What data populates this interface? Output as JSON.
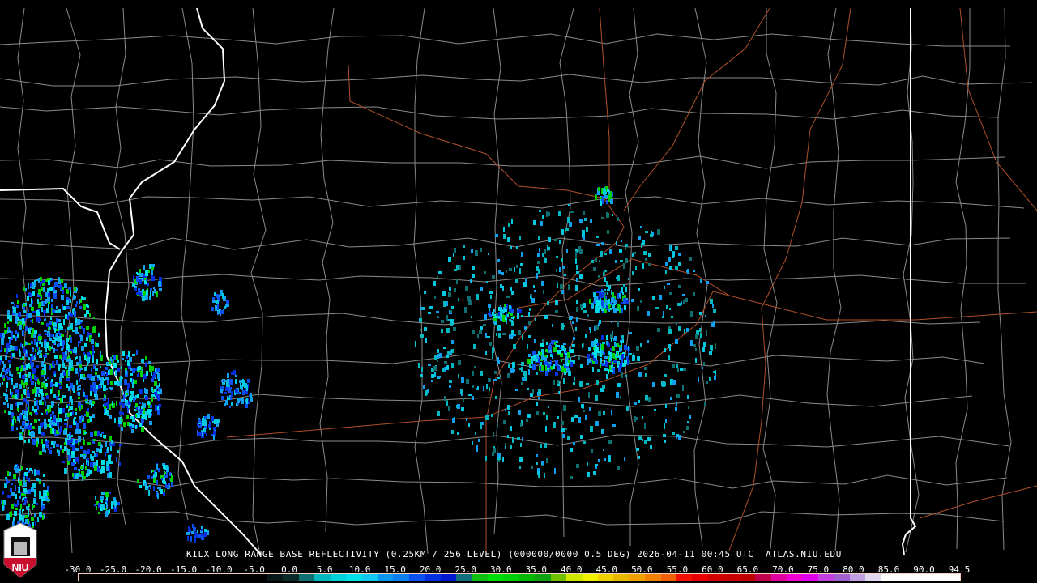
{
  "product_title": "KILX LONG RANGE BASE REFLECTIVITY (0.25KM / 256 LEVEL) (000000/0000 0.5 DEG) 2026-04-11 00:45 UTC  ATLAS.NIU.EDU",
  "logo_text": "NIU",
  "colorbar": {
    "labels": [
      "-30.0",
      "-25.0",
      "-20.0",
      "-15.0",
      "-10.0",
      "-5.0",
      "0.0",
      "5.0",
      "10.0",
      "15.0",
      "20.0",
      "25.0",
      "30.0",
      "35.0",
      "40.0",
      "45.0",
      "50.0",
      "55.0",
      "60.0",
      "65.0",
      "70.0",
      "75.0",
      "80.0",
      "85.0",
      "90.0",
      "94.5"
    ],
    "colors": [
      "#000000",
      "#000000",
      "#000000",
      "#000000",
      "#000000",
      "#000000",
      "#000000",
      "#000000",
      "#000000",
      "#000000",
      "#000000",
      "#000000",
      "#081818",
      "#0a2a2a",
      "#0e7070",
      "#00b8c0",
      "#00d0d8",
      "#00e0e8",
      "#10c8f0",
      "#0898f0",
      "#0a80f0",
      "#0850f0",
      "#0030e0",
      "#0018d0",
      "#107080",
      "#10c010",
      "#00e000",
      "#00d000",
      "#00b800",
      "#10a010",
      "#70c000",
      "#d0e800",
      "#f0f000",
      "#f0d000",
      "#e8b800",
      "#f0a000",
      "#f08000",
      "#f06000",
      "#f01000",
      "#e80000",
      "#d00000",
      "#c80000",
      "#c00000",
      "#c0004a",
      "#e000a0",
      "#f000d0",
      "#e000f0",
      "#c040e0",
      "#a060d0",
      "#c0a0e0",
      "#e0d8f0",
      "#ffffff",
      "#ffffff",
      "#ffffff",
      "#ffffff",
      "#ffffff"
    ]
  }
}
